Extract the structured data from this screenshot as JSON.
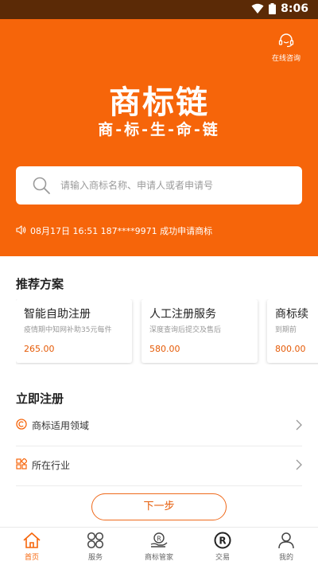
{
  "status_bar": {
    "time": "8:06"
  },
  "header": {
    "consult_label": "在线咨询",
    "logo_title": "商标链",
    "logo_subtitle": "商-标-生-命-链"
  },
  "search": {
    "placeholder": "请输入商标名称、申请人或者申请号"
  },
  "notice": {
    "text": "08月17日 16:51 187****9971 成功申请商标"
  },
  "recommend": {
    "title": "推荐方案",
    "cards": [
      {
        "title": "智能自助注册",
        "desc": "疫情期中知网补助35元每件",
        "price": "265.00"
      },
      {
        "title": "人工注册服务",
        "desc": "深度查询后提交及售后",
        "price": "580.00"
      },
      {
        "title": "商标续",
        "desc": "到期前",
        "price": "800.00"
      }
    ]
  },
  "register": {
    "title": "立即注册",
    "rows": [
      {
        "label": "商标适用领域",
        "icon": "copyright-icon"
      },
      {
        "label": "所在行业",
        "icon": "grid-icon"
      }
    ],
    "next_label": "下一步"
  },
  "tabs": [
    {
      "label": "首页",
      "icon": "home-icon",
      "active": true
    },
    {
      "label": "服务",
      "icon": "apps-icon",
      "active": false
    },
    {
      "label": "商标管家",
      "icon": "trademark-hand-icon",
      "active": false
    },
    {
      "label": "交易",
      "icon": "trademark-icon",
      "active": false
    },
    {
      "label": "我的",
      "icon": "user-icon",
      "active": false
    }
  ],
  "colors": {
    "brand": "#f6650a",
    "status_bar": "#5b2a06",
    "price": "#e55a06"
  }
}
